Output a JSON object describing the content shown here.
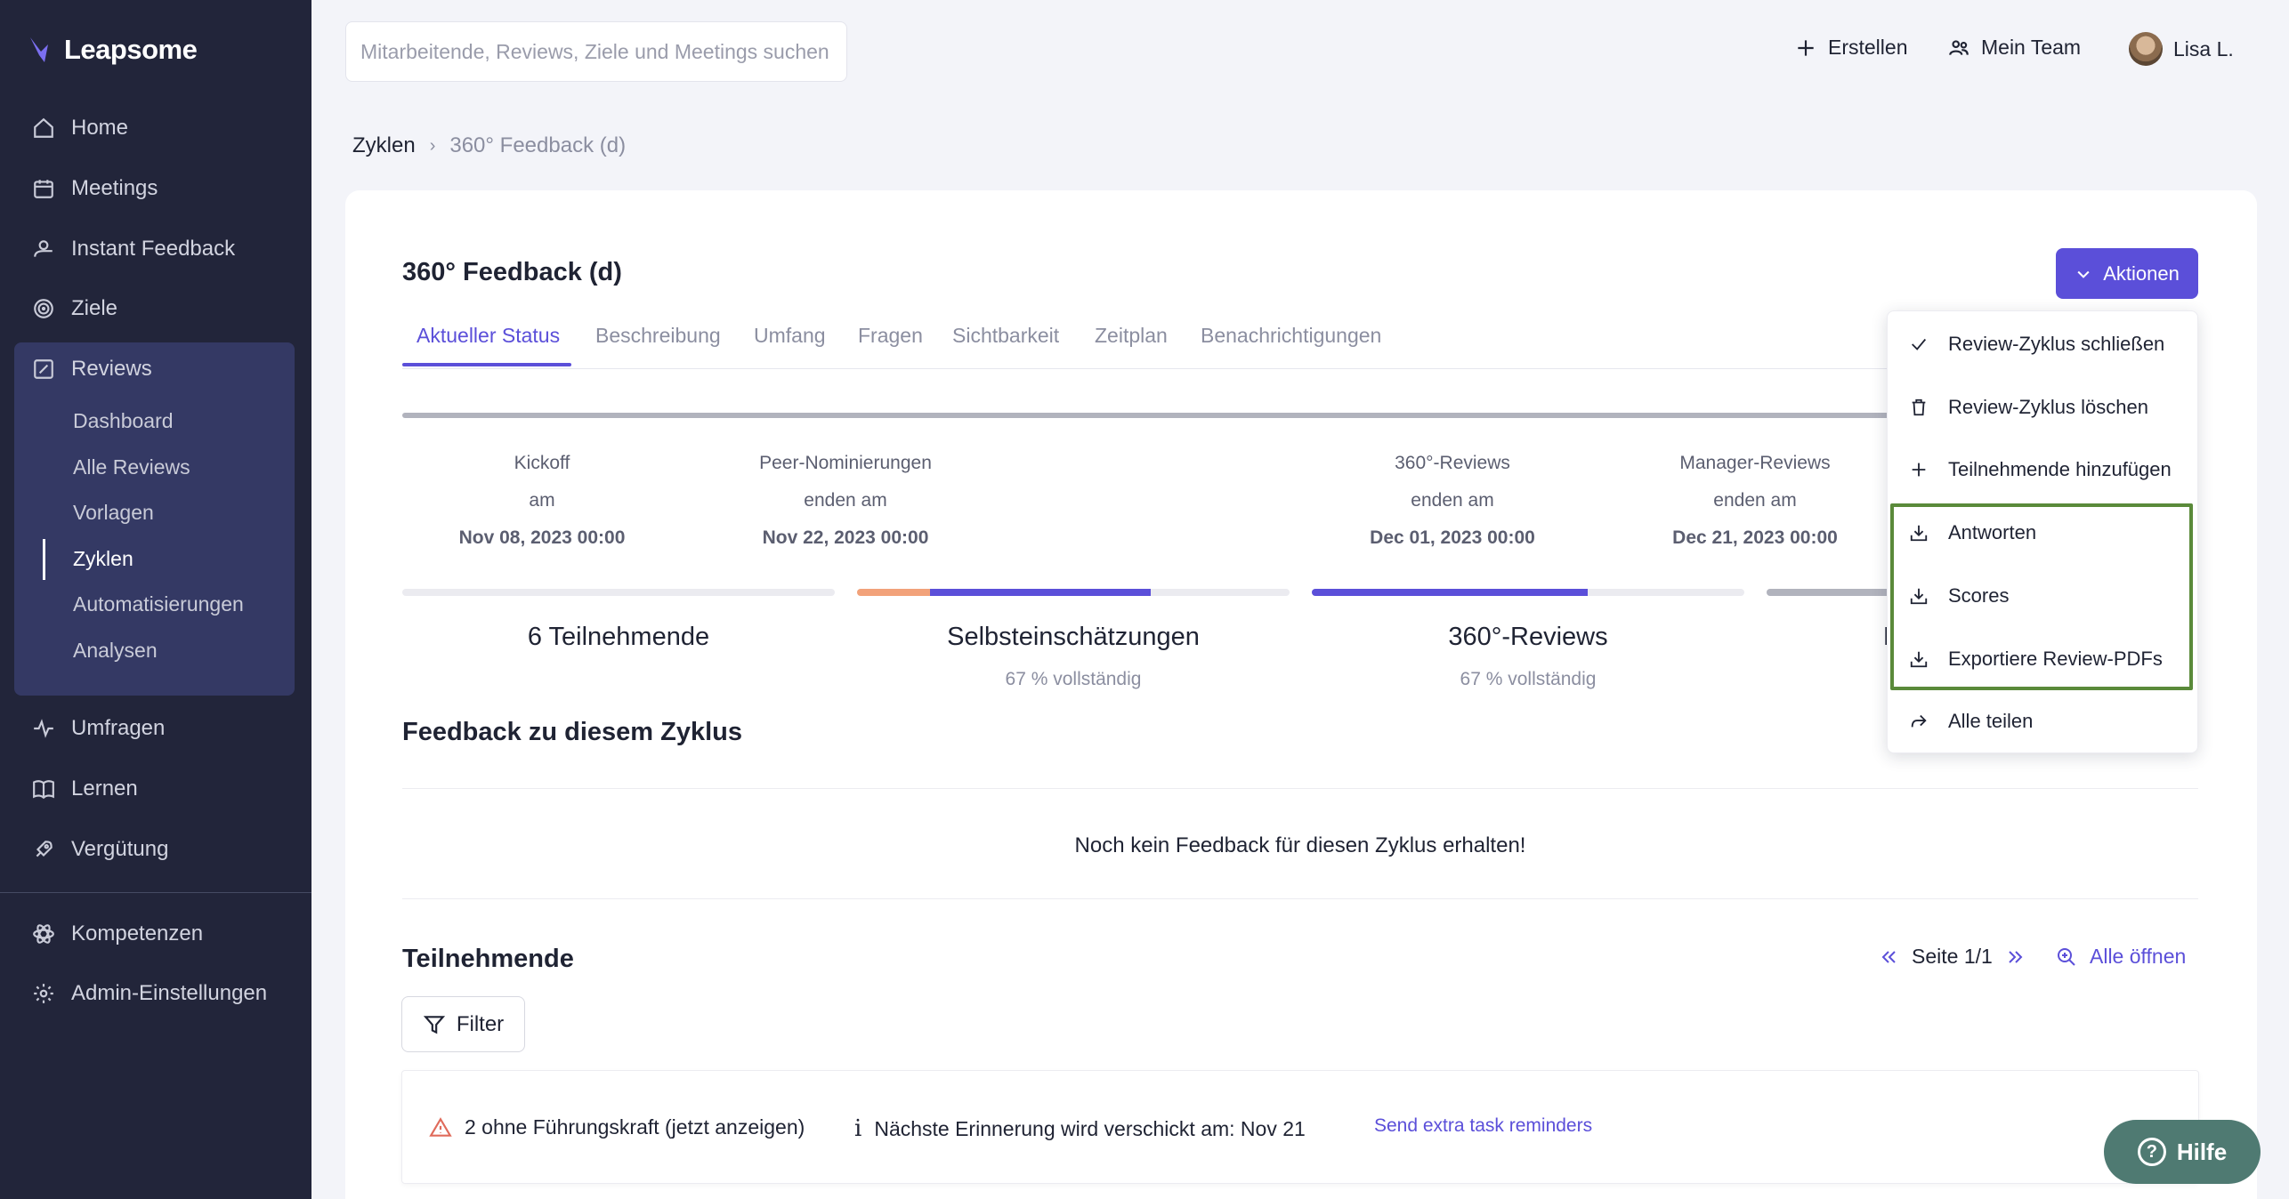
{
  "app": {
    "name": "Leapsome"
  },
  "sidebar": {
    "items": [
      {
        "label": "Home",
        "icon": "home-icon"
      },
      {
        "label": "Meetings",
        "icon": "calendar-icon"
      },
      {
        "label": "Instant Feedback",
        "icon": "feedback-icon"
      },
      {
        "label": "Ziele",
        "icon": "target-icon"
      },
      {
        "label": "Reviews",
        "icon": "edit-icon"
      }
    ],
    "reviews_sub": [
      "Dashboard",
      "Alle Reviews",
      "Vorlagen",
      "Zyklen",
      "Automatisierungen",
      "Analysen"
    ],
    "items_after": [
      {
        "label": "Umfragen",
        "icon": "pulse-icon"
      },
      {
        "label": "Lernen",
        "icon": "book-icon"
      },
      {
        "label": "Vergütung",
        "icon": "rocket-icon"
      }
    ],
    "bottom": [
      {
        "label": "Kompetenzen",
        "icon": "atom-icon"
      },
      {
        "label": "Admin-Einstellungen",
        "icon": "gear-icon"
      }
    ]
  },
  "header": {
    "search_placeholder": "Mitarbeitende, Reviews, Ziele und Meetings suchen",
    "create": "Erstellen",
    "team": "Mein Team",
    "user": "Lisa L."
  },
  "breadcrumb": {
    "root": "Zyklen",
    "current": "360° Feedback (d)"
  },
  "page": {
    "title": "360° Feedback (d)",
    "actions_label": "Aktionen",
    "tabs": [
      "Aktueller Status",
      "Beschreibung",
      "Umfang",
      "Fragen",
      "Sichtbarkeit",
      "Zeitplan",
      "Benachrichtigungen"
    ]
  },
  "timeline": [
    {
      "line1": "Kickoff",
      "line2": "am",
      "date": "Nov 08, 2023 00:00"
    },
    {
      "line1": "Peer-Nominierungen",
      "line2": "enden am",
      "date": "Nov 22, 2023 00:00"
    },
    {
      "line1": "360°-Reviews",
      "line2": "enden am",
      "date": "Dec 01, 2023 00:00"
    },
    {
      "line1": "Manager-Reviews",
      "line2": "enden am",
      "date": "Dec 21, 2023 00:00"
    }
  ],
  "stats": [
    {
      "label": "6 Teilnehmende",
      "sub": "",
      "progress": 0
    },
    {
      "label": "Selbsteinschätzungen",
      "sub": "67 % vollständig",
      "progress": 0.67
    },
    {
      "label": "360°-Reviews",
      "sub": "67 % vollständig",
      "progress": 0.67
    },
    {
      "label": "M",
      "sub": "",
      "progress": 0.3
    }
  ],
  "feedback": {
    "title": "Feedback zu diesem Zyklus",
    "empty": "Noch kein Feedback für diesen Zyklus erhalten!"
  },
  "participants": {
    "title": "Teilnehmende",
    "page": "Seite 1/1",
    "open_all": "Alle öffnen",
    "filter": "Filter",
    "warning": "2 ohne Führungskraft (jetzt anzeigen)",
    "reminder": "Nächste Erinnerung wird verschickt am: Nov 21",
    "send_reminders": "Send extra task reminders"
  },
  "dropdown": [
    {
      "label": "Review-Zyklus schließen",
      "icon": "check-icon"
    },
    {
      "label": "Review-Zyklus löschen",
      "icon": "trash-icon"
    },
    {
      "label": "Teilnehmende hinzufügen",
      "icon": "plus-icon"
    },
    {
      "label": "Antworten",
      "icon": "download-icon"
    },
    {
      "label": "Scores",
      "icon": "download-icon"
    },
    {
      "label": "Exportiere Review-PDFs",
      "icon": "download-icon"
    },
    {
      "label": "Alle teilen",
      "icon": "share-icon"
    }
  ],
  "help": {
    "label": "Hilfe"
  },
  "colors": {
    "accent": "#5b4fd9",
    "sidebar": "#22253a",
    "highlight": "#5a8a3a",
    "orange": "#f2a27a"
  }
}
